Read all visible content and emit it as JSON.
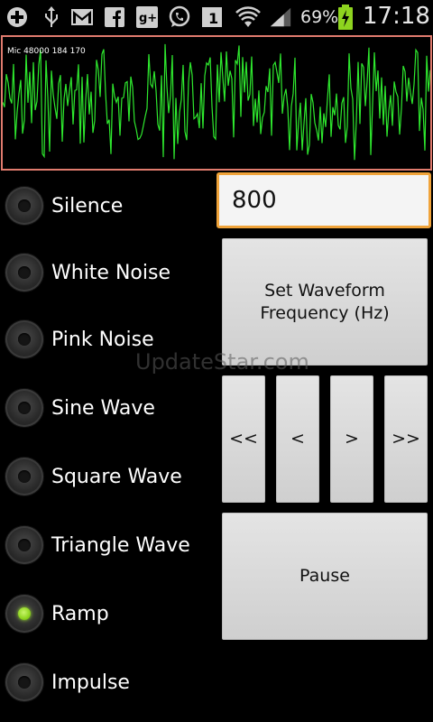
{
  "status_bar": {
    "icons": [
      "add-icon",
      "usb-icon",
      "gmail-icon",
      "facebook-icon",
      "google-plus-icon",
      "whatsapp-icon",
      "notification-1-icon",
      "wifi-icon",
      "signal-icon",
      "battery-charging-icon"
    ],
    "badge_number": "1",
    "battery_percent": "69%",
    "time": "17:18"
  },
  "scope": {
    "label": "Mic 48000 184 170",
    "trace_color": "#2ee82e",
    "border_color": "#e07b6e"
  },
  "waveforms": {
    "options": [
      "Silence",
      "White Noise",
      "Pink Noise",
      "Sine Wave",
      "Square Wave",
      "Triangle Wave",
      "Ramp",
      "Impulse"
    ],
    "selected": "Ramp"
  },
  "frequency": {
    "value": "800"
  },
  "buttons": {
    "set_frequency": "Set Waveform Frequency (Hz)",
    "step_down_big": "<<",
    "step_down": "<",
    "step_up": ">",
    "step_up_big": ">>",
    "pause": "Pause"
  },
  "watermark": "UpdateStar.com",
  "colors": {
    "accent_focus": "#f0a33a",
    "radio_selected": "#8ed41f",
    "background": "#000000"
  }
}
